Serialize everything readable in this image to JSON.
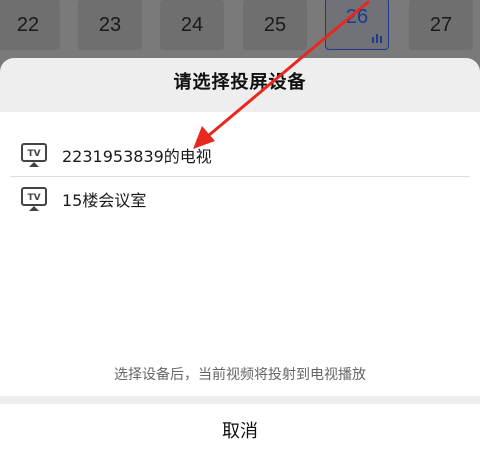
{
  "episodes": [
    {
      "number": "22",
      "active": false
    },
    {
      "number": "23",
      "active": false
    },
    {
      "number": "24",
      "active": false
    },
    {
      "number": "25",
      "active": false
    },
    {
      "number": "26",
      "active": true
    },
    {
      "number": "27",
      "active": false
    }
  ],
  "sheet": {
    "title": "请选择投屏设备",
    "devices": [
      {
        "label": "2231953839的电视",
        "icon": "tv-cast-icon",
        "icon_text": "TV"
      },
      {
        "label": "15楼会议室",
        "icon": "tv-cast-icon",
        "icon_text": "TV"
      }
    ],
    "hint": "选择设备后，当前视频将投射到电视播放",
    "cancel_label": "取消"
  },
  "colors": {
    "overlay": "#7a7a7a",
    "sheet_bg": "#eeeeee",
    "panel_bg": "#ffffff",
    "accent": "#1e3a8a",
    "annotation_arrow": "#e8281e"
  },
  "icons": {
    "playing": "playing-bars-icon",
    "annotation": "red-arrow-annotation"
  }
}
